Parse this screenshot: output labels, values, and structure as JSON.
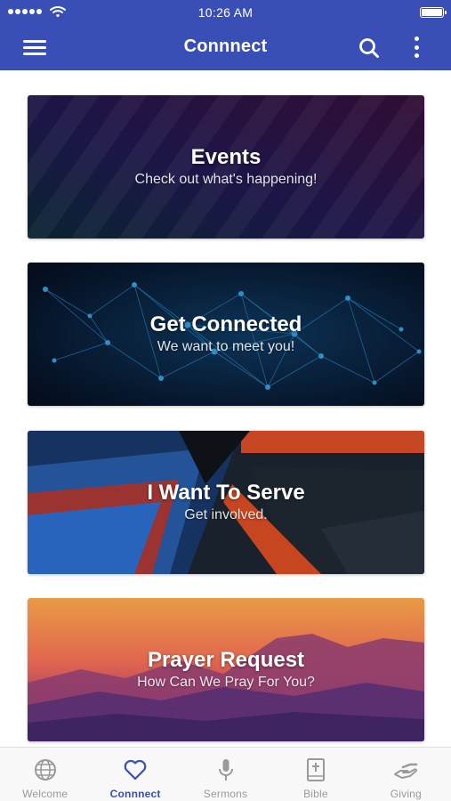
{
  "status_bar": {
    "time": "10:26 AM"
  },
  "header": {
    "title": "Connnect",
    "icons": [
      "menu-icon",
      "search-icon",
      "more-vertical-icon"
    ]
  },
  "cards": [
    {
      "title": "Events",
      "subtitle": "Check out what's happening!"
    },
    {
      "title": "Get Connected",
      "subtitle": "We want to meet you!"
    },
    {
      "title": "I Want To Serve",
      "subtitle": "Get involved."
    },
    {
      "title": "Prayer Request",
      "subtitle": "How Can We Pray For You?"
    }
  ],
  "tabs": [
    {
      "label": "Welcome",
      "icon": "globe-icon"
    },
    {
      "label": "Connnect",
      "icon": "heart-icon",
      "active": true
    },
    {
      "label": "Sermons",
      "icon": "microphone-icon"
    },
    {
      "label": "Bible",
      "icon": "bible-icon"
    },
    {
      "label": "Giving",
      "icon": "giving-hand-icon"
    }
  ],
  "colors": {
    "header": "#3a4fb5",
    "active_tab": "#3a4fb5",
    "inactive_tab": "#9a9a9a"
  }
}
